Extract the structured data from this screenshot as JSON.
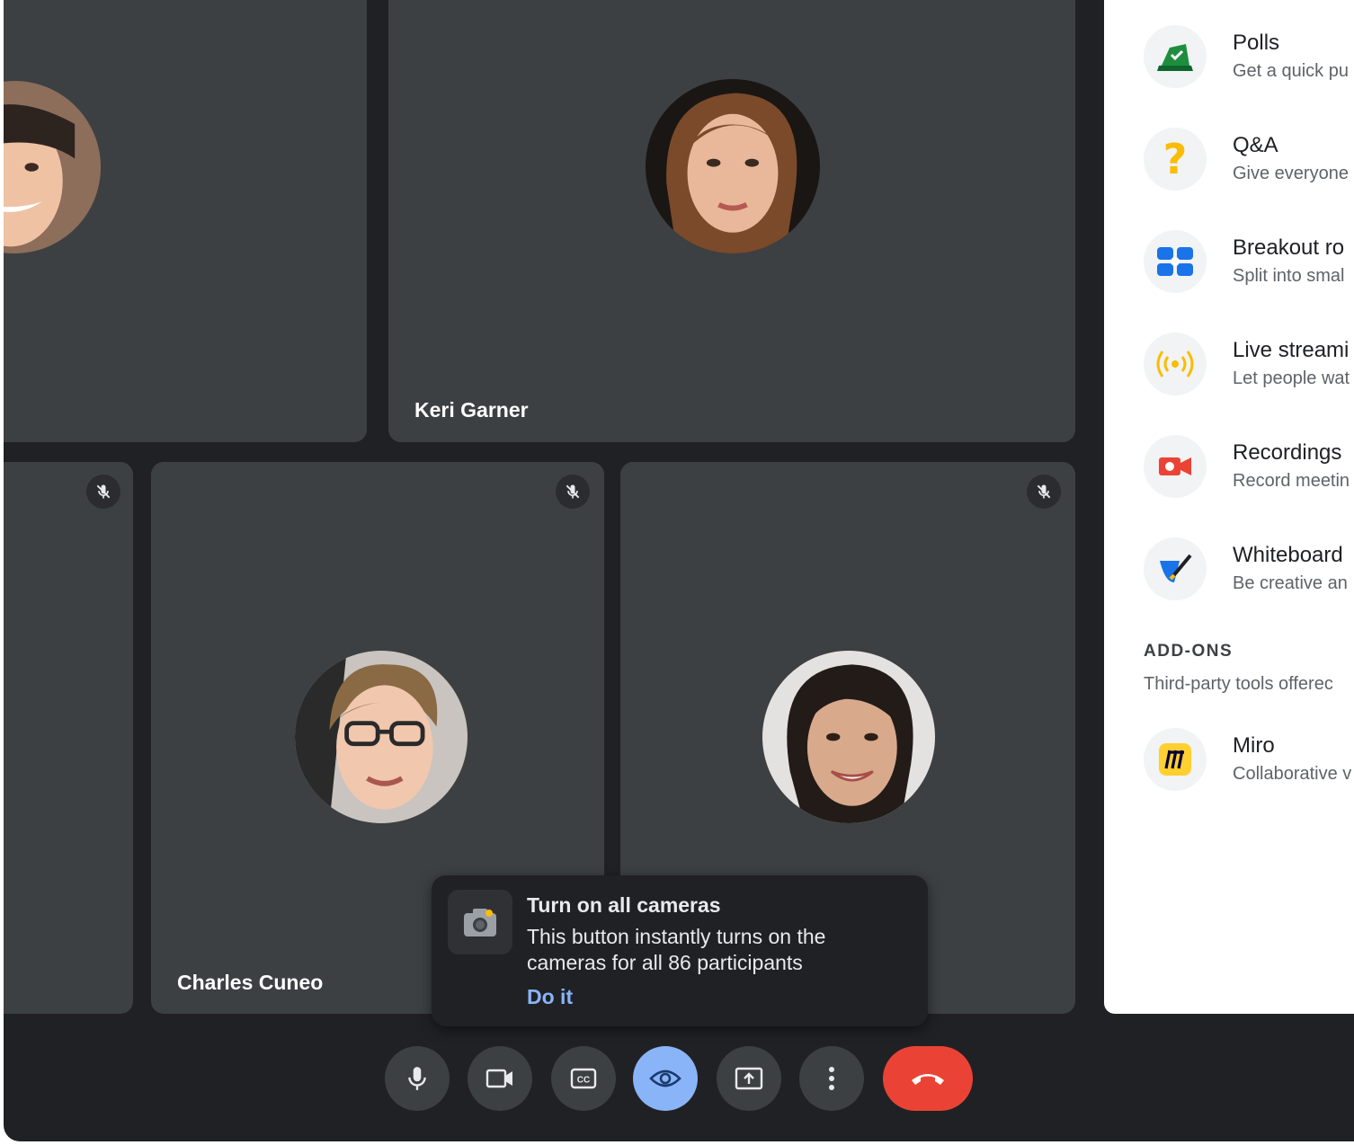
{
  "participants": [
    {
      "name": "",
      "muted": false
    },
    {
      "name": "Keri Garner",
      "muted": false
    },
    {
      "name": "",
      "muted": true
    },
    {
      "name": "Charles Cuneo",
      "muted": true
    },
    {
      "name": "",
      "muted": true
    }
  ],
  "tooltip": {
    "title": "Turn on all cameras",
    "body": "This button instantly turns on the cameras for all 86 participants",
    "action": "Do it"
  },
  "controls": [
    {
      "name": "microphone",
      "icon": "mic-icon"
    },
    {
      "name": "camera",
      "icon": "videocam-icon"
    },
    {
      "name": "captions",
      "icon": "closed-caption-icon"
    },
    {
      "name": "camera-all",
      "icon": "eye-icon",
      "active": true
    },
    {
      "name": "present",
      "icon": "present-screen-icon"
    },
    {
      "name": "more-options",
      "icon": "more-vert-icon"
    },
    {
      "name": "leave-call",
      "icon": "call-end-icon"
    }
  ],
  "activities": {
    "items": [
      {
        "title": "Polls",
        "subtitle": "Get a quick pu",
        "icon": "polls-icon"
      },
      {
        "title": "Q&A",
        "subtitle": "Give everyone",
        "icon": "question-icon"
      },
      {
        "title": "Breakout ro",
        "subtitle": "Split into smal",
        "icon": "breakout-rooms-icon"
      },
      {
        "title": "Live streami",
        "subtitle": "Let people wat",
        "icon": "live-stream-icon"
      },
      {
        "title": "Recordings",
        "subtitle": "Record meetin",
        "icon": "recording-icon"
      },
      {
        "title": "Whiteboard",
        "subtitle": "Be creative an",
        "icon": "whiteboard-icon"
      }
    ],
    "addons_heading": "ADD-ONS",
    "addons_subheading": "Third-party tools offerec",
    "addons": [
      {
        "title": "Miro",
        "subtitle": "Collaborative v",
        "icon": "miro-icon"
      }
    ]
  },
  "colors": {
    "background": "#202124",
    "tile": "#3c4043",
    "accent": "#8ab4f8",
    "end_call": "#ea4335"
  }
}
